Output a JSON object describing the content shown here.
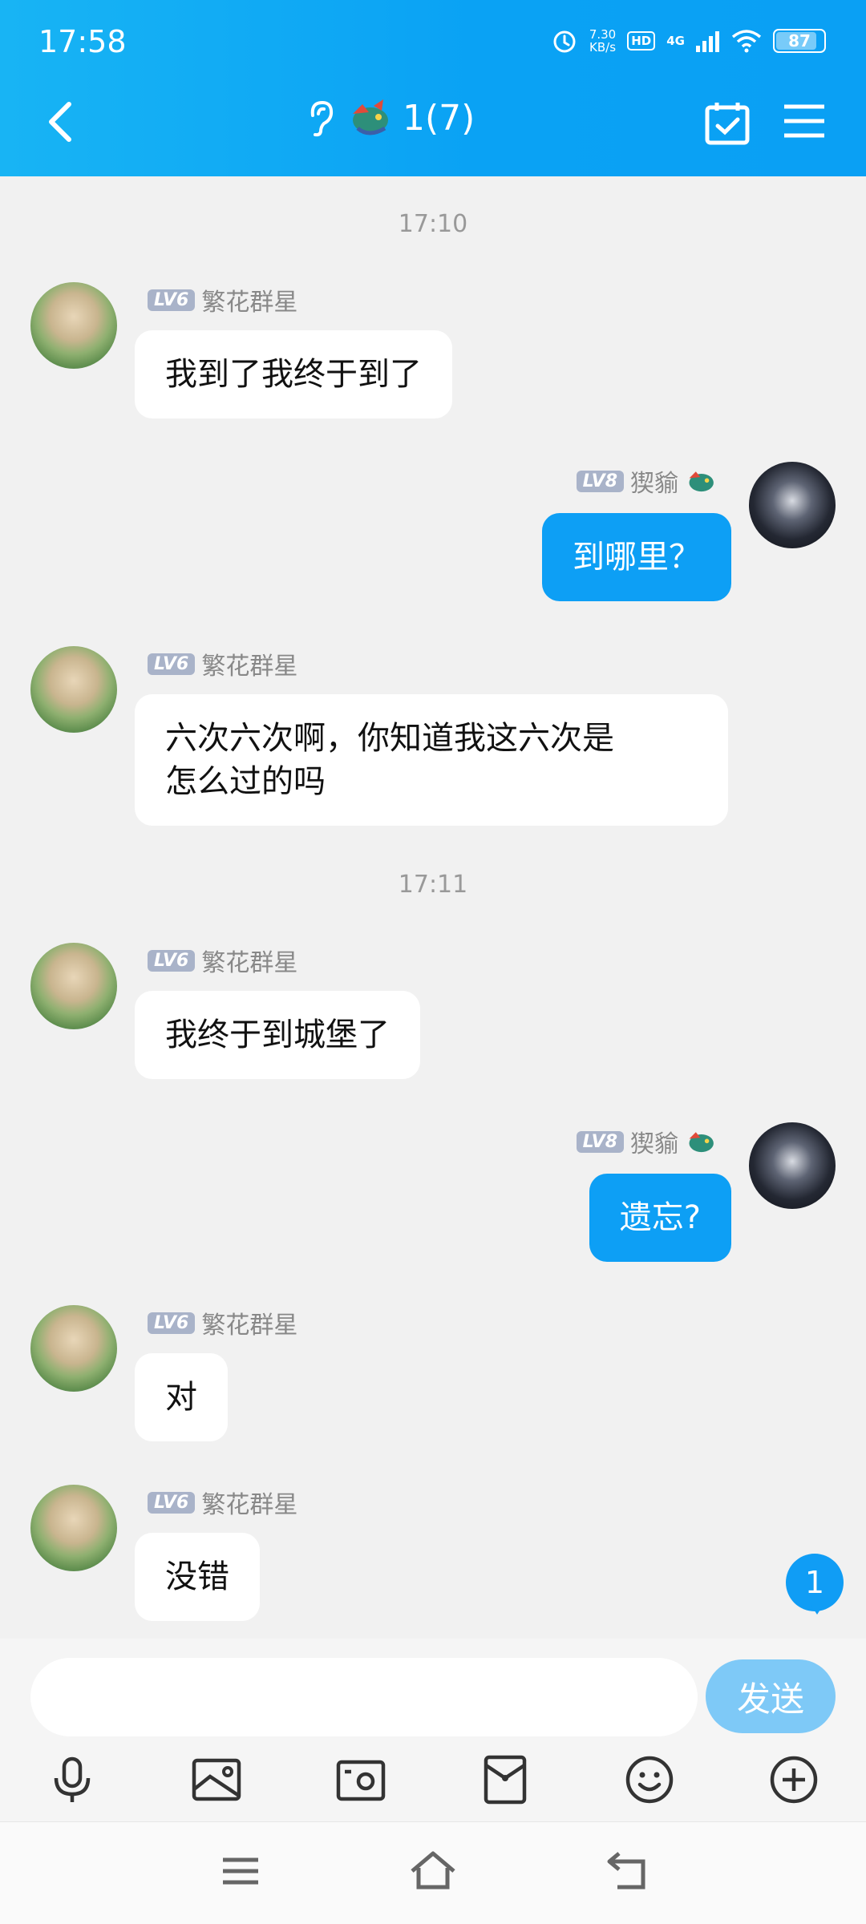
{
  "status_bar": {
    "time": "17:58",
    "net_speed_value": "7.30",
    "net_speed_unit": "KB/s",
    "hd": "HD",
    "network": "4G",
    "battery": "87",
    "battery_level_percent": 87
  },
  "header": {
    "title": "1(7)"
  },
  "messages": [
    {
      "timestamp": "17:10"
    },
    {
      "level": "LV6",
      "name": "繁花群星",
      "text": "我到了我终于到了"
    },
    {
      "level": "LV8",
      "name": "猰貐",
      "text": "到哪里？"
    },
    {
      "level": "LV6",
      "name": "繁花群星",
      "text_line1": "六次六次啊，你知道我这六次是",
      "text_line2": "怎么过的吗"
    },
    {
      "timestamp": "17:11"
    },
    {
      "level": "LV6",
      "name": "繁花群星",
      "text": "我终于到城堡了"
    },
    {
      "level": "LV8",
      "name": "猰貐",
      "text": "遗忘?"
    },
    {
      "level": "LV6",
      "name": "繁花群星",
      "text": "对"
    },
    {
      "level": "LV6",
      "name": "繁花群星",
      "text": "没错"
    }
  ],
  "unread_badge": "1",
  "composer": {
    "input_value": "",
    "send_label": "发送"
  },
  "icons": {
    "back": "chevron-left-icon",
    "ear": "ear-icon",
    "dragon": "dragon-icon",
    "calendar": "calendar-check-icon",
    "menu": "menu-icon",
    "toolbar": [
      "microphone-icon",
      "image-icon",
      "camera-icon",
      "red-packet-icon",
      "emoji-icon",
      "plus-circle-icon"
    ],
    "nav": [
      "recents-icon",
      "home-icon",
      "back-icon"
    ]
  },
  "colors": {
    "accent": "#0d9ff5",
    "header_start": "#18b4f4",
    "bubble_out": "#0d9ff5",
    "bubble_in": "#ffffff",
    "background": "#f1f1f1",
    "send_disabled": "#7ec9f7"
  }
}
